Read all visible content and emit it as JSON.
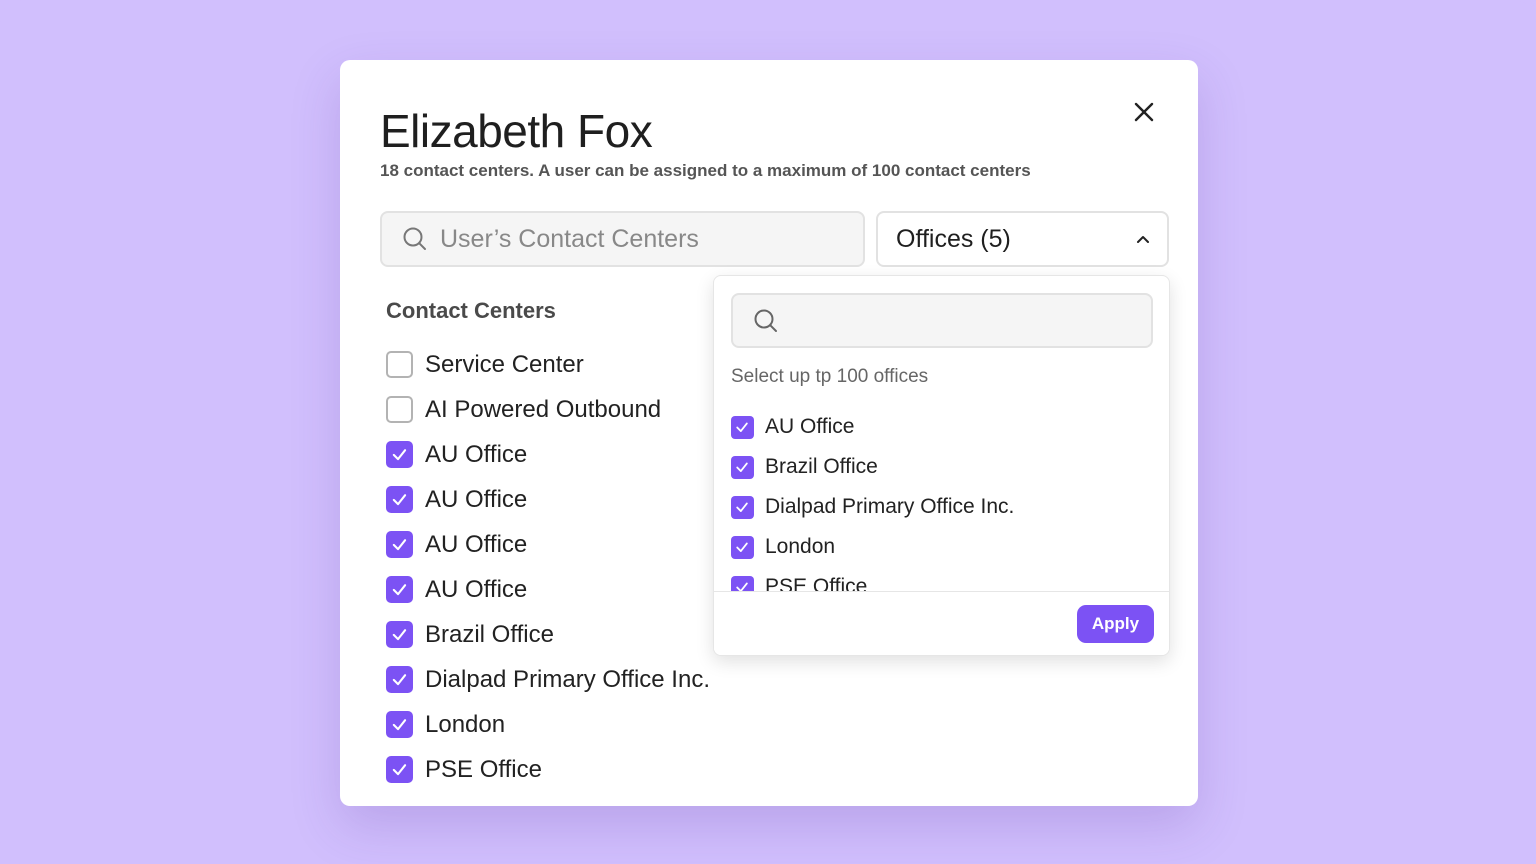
{
  "modal": {
    "title": "Elizabeth Fox",
    "subtitle": "18 contact centers. A user can be assigned to a maximum of 100 contact centers",
    "close_icon": "close-icon"
  },
  "search": {
    "placeholder": "User’s Contact Centers",
    "icon": "search-icon"
  },
  "offices_select": {
    "label": "Offices (5)",
    "icon": "chevron-up-icon",
    "expanded": true
  },
  "contact_centers": {
    "heading": "Contact Centers",
    "items": [
      {
        "label": "Service Center",
        "checked": false
      },
      {
        "label": "AI Powered Outbound",
        "checked": false
      },
      {
        "label": "AU Office",
        "checked": true
      },
      {
        "label": "AU Office",
        "checked": true
      },
      {
        "label": "AU Office",
        "checked": true
      },
      {
        "label": "AU Office",
        "checked": true
      },
      {
        "label": "Brazil Office",
        "checked": true
      },
      {
        "label": "Dialpad Primary Office Inc.",
        "checked": true
      },
      {
        "label": "London",
        "checked": true
      },
      {
        "label": "PSE Office",
        "checked": true
      }
    ]
  },
  "offices_dropdown": {
    "search_value": "",
    "hint": "Select up tp 100 offices",
    "items": [
      {
        "label": "AU Office",
        "checked": true
      },
      {
        "label": "Brazil Office",
        "checked": true
      },
      {
        "label": "Dialpad Primary Office Inc.",
        "checked": true
      },
      {
        "label": "London",
        "checked": true
      },
      {
        "label": "PSE Office",
        "checked": true
      }
    ],
    "apply_label": "Apply"
  },
  "colors": {
    "background": "#d1bffd",
    "accent": "#7c52f4"
  }
}
